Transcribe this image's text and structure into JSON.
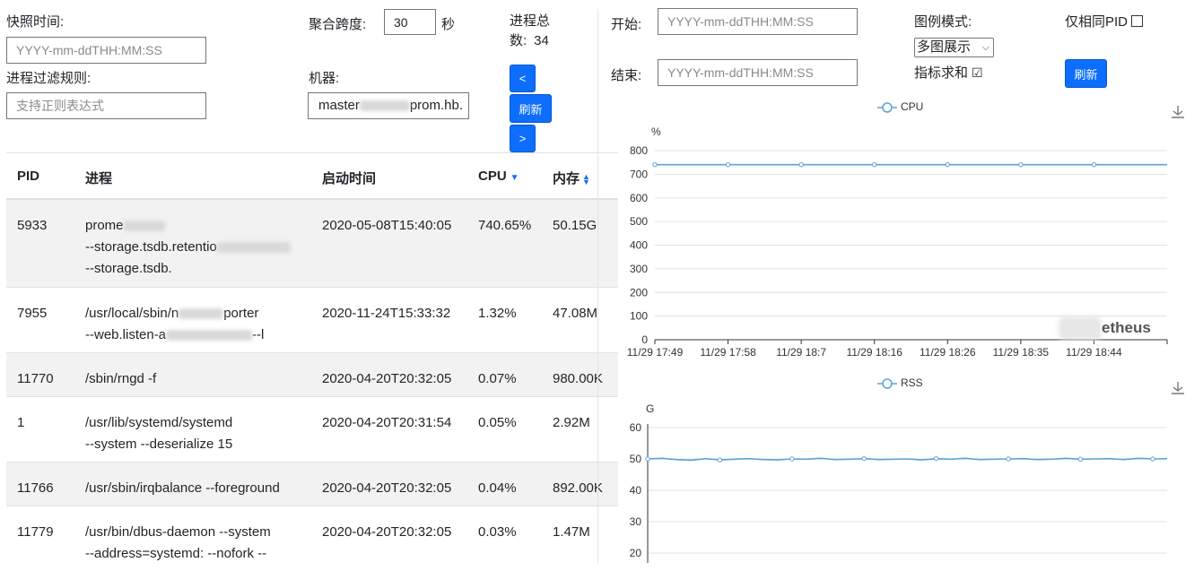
{
  "left_form": {
    "snapshot_label": "快照时间:",
    "snapshot_placeholder": "YYYY-mm-ddTHH:MM:SS",
    "filter_label": "进程过滤规则:",
    "filter_placeholder": "支持正则表达式",
    "agg_label": "聚合跨度:",
    "agg_value": "30",
    "agg_unit": "秒",
    "machine_label": "机器:",
    "machine_prefix": "master",
    "machine_suffix": "prom.hb.",
    "proc_total_label_1": "进程总",
    "proc_total_label_2": "数:",
    "proc_total_value": "34",
    "prev_label": "<",
    "refresh_label": "刷新",
    "next_label": ">"
  },
  "right_form": {
    "start_label": "开始:",
    "start_placeholder": "YYYY-mm-ddTHH:MM:SS",
    "end_label": "结束:",
    "end_placeholder": "YYYY-mm-ddTHH:MM:SS",
    "legend_mode_label": "图例模式:",
    "legend_mode_value": "多图展示",
    "metric_sum_label": "指标求和",
    "metric_sum_checked": "☑",
    "same_pid_label": "仅相同PID",
    "refresh_label": "刷新"
  },
  "table": {
    "headers": [
      "PID",
      "进程",
      "启动时间",
      "CPU",
      "内存"
    ],
    "rows": [
      {
        "pid": "5933",
        "lines": [
          "prome",
          "--storage.tsdb.retentio",
          "--storage.tsdb."
        ],
        "start": "2020-05-08T15:40:05",
        "cpu": "740.65%",
        "mem": "50.15G"
      },
      {
        "pid": "7955",
        "lines": [
          "/usr/local/sbin/n",
          "--web.listen-a"
        ],
        "line_tails": [
          "porter",
          "--l"
        ],
        "start": "2020-11-24T15:33:32",
        "cpu": "1.32%",
        "mem": "47.08M"
      },
      {
        "pid": "11770",
        "lines": [
          "/sbin/rngd -f"
        ],
        "start": "2020-04-20T20:32:05",
        "cpu": "0.07%",
        "mem": "980.00K"
      },
      {
        "pid": "1",
        "lines": [
          "/usr/lib/systemd/systemd",
          "--system --deserialize 15"
        ],
        "start": "2020-04-20T20:31:54",
        "cpu": "0.05%",
        "mem": "2.92M"
      },
      {
        "pid": "11766",
        "lines": [
          "/usr/sbin/irqbalance --foreground"
        ],
        "start": "2020-04-20T20:32:05",
        "cpu": "0.04%",
        "mem": "892.00K"
      },
      {
        "pid": "11779",
        "lines": [
          "/usr/bin/dbus-daemon --system",
          "--address=systemd: --nofork --"
        ],
        "start": "2020-04-20T20:32:05",
        "cpu": "0.03%",
        "mem": "1.47M"
      }
    ]
  },
  "chart_data": [
    {
      "type": "line",
      "series": [
        {
          "name": "CPU",
          "values": [
            740.65,
            740.65,
            740.65,
            740.65,
            740.65,
            740.65,
            740.65,
            740.65
          ]
        }
      ],
      "x": [
        "11/29 17:49",
        "11/29 17:58",
        "11/29 18:7",
        "11/29 18:16",
        "11/29 18:26",
        "11/29 18:35",
        "11/29 18:44",
        ""
      ],
      "ylabel": "%",
      "ylim": [
        0,
        800
      ],
      "yticks": [
        0,
        100,
        200,
        300,
        400,
        500,
        600,
        700,
        800
      ],
      "watermark": "etheus",
      "color": "#5aa3d6"
    },
    {
      "type": "line",
      "series": [
        {
          "name": "RSS",
          "values": [
            50.0,
            50.2,
            49.8,
            49.6,
            50.1,
            49.7,
            49.9,
            50.1,
            49.8,
            49.7,
            50.0,
            49.9,
            50.2,
            49.8,
            49.9,
            50.1,
            49.8,
            49.9,
            50.0,
            49.7,
            50.1,
            49.9,
            50.2,
            49.8,
            49.9,
            50.0,
            50.1,
            49.8,
            49.9,
            50.2,
            49.9,
            50.0,
            50.1,
            49.8,
            50.2,
            50.0,
            50.1
          ]
        }
      ],
      "ylabel": "G",
      "ylim": [
        20,
        60
      ],
      "yticks": [
        20,
        30,
        40,
        50,
        60
      ],
      "color": "#5aa3d6"
    }
  ]
}
